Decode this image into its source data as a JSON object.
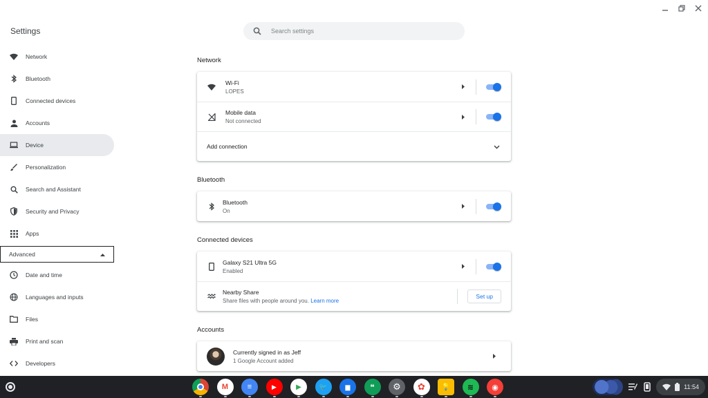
{
  "app": {
    "title": "Settings"
  },
  "search": {
    "placeholder": "Search settings"
  },
  "sidebar": {
    "items": [
      {
        "label": "Network",
        "icon": "wifi-icon"
      },
      {
        "label": "Bluetooth",
        "icon": "bluetooth-icon"
      },
      {
        "label": "Connected devices",
        "icon": "phone-icon"
      },
      {
        "label": "Accounts",
        "icon": "person-icon"
      },
      {
        "label": "Device",
        "icon": "laptop-icon",
        "active": true
      },
      {
        "label": "Personalization",
        "icon": "brush-icon"
      },
      {
        "label": "Search and Assistant",
        "icon": "search-icon"
      },
      {
        "label": "Security and Privacy",
        "icon": "shield-icon"
      },
      {
        "label": "Apps",
        "icon": "apps-grid-icon"
      }
    ],
    "advanced_label": "Advanced",
    "advanced_items": [
      {
        "label": "Date and time",
        "icon": "clock-icon"
      },
      {
        "label": "Languages and inputs",
        "icon": "globe-icon"
      },
      {
        "label": "Files",
        "icon": "folder-icon"
      },
      {
        "label": "Print and scan",
        "icon": "printer-icon"
      },
      {
        "label": "Developers",
        "icon": "code-icon"
      }
    ]
  },
  "sections": {
    "network": {
      "title": "Network",
      "wifi": {
        "name": "Wi-Fi",
        "status": "LOPES",
        "enabled": true
      },
      "mobile": {
        "name": "Mobile data",
        "status": "Not connected",
        "enabled": true
      },
      "add_connection": "Add connection"
    },
    "bluetooth": {
      "title": "Bluetooth",
      "item": {
        "name": "Bluetooth",
        "status": "On",
        "enabled": true
      }
    },
    "connected_devices": {
      "title": "Connected devices",
      "phone": {
        "name": "Galaxy S21 Ultra 5G",
        "status": "Enabled",
        "enabled": true
      },
      "nearby": {
        "name": "Nearby Share",
        "desc": "Share files with people around you.",
        "link": "Learn more",
        "button": "Set up"
      }
    },
    "accounts": {
      "title": "Accounts",
      "signed_in": "Currently signed in as Jeff",
      "summary": "1 Google Account added"
    }
  },
  "shelf": {
    "apps": [
      {
        "name": "chrome",
        "color": "#4285f4",
        "glyph": ""
      },
      {
        "name": "gmail",
        "color": "#ffffff",
        "glyph": "M"
      },
      {
        "name": "docs",
        "color": "#4285f4",
        "glyph": "≡"
      },
      {
        "name": "youtube",
        "color": "#ff0000",
        "glyph": "▶"
      },
      {
        "name": "play-store",
        "color": "#ffffff",
        "glyph": "▶"
      },
      {
        "name": "twitter",
        "color": "#1da1f2",
        "glyph": "🐦"
      },
      {
        "name": "files",
        "color": "#1a73e8",
        "glyph": "▆"
      },
      {
        "name": "hangouts",
        "color": "#0f9d58",
        "glyph": "❝"
      },
      {
        "name": "settings",
        "color": "#5f6368",
        "glyph": "⚙"
      },
      {
        "name": "photos",
        "color": "#ffffff",
        "glyph": "✿"
      },
      {
        "name": "keep",
        "color": "#fbbc04",
        "glyph": "💡"
      },
      {
        "name": "spotify",
        "color": "#1db954",
        "glyph": "≋"
      },
      {
        "name": "pocket-casts",
        "color": "#f43e37",
        "glyph": "◉"
      }
    ],
    "clock": "11:54"
  }
}
